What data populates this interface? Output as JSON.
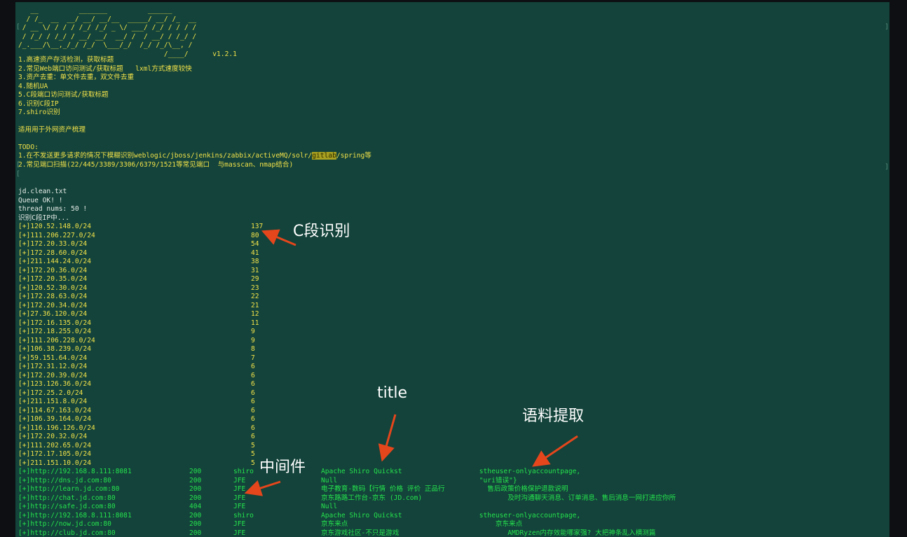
{
  "banner": [
    "   __          _______          ______",
    "  / /_  __  __/ __/ __/__  _____/ __/ /_  __",
    " / __ \\/ / / / /_/ /_/ _ \\/ ___/ /_/ / / / /",
    " / /_/ / /_/ / __/ __/  __/ /  / __/ / /_/ /",
    "/_.___/\\__,_/_/ /_/  \\___/_/  /_/ /_/\\__, /",
    "                                    /____/      v1.2.1"
  ],
  "menu": [
    "1.高速资产存活检测，获取标题",
    "2.常见Web端口访问测试/获取标题   lxml方式速度较快",
    "3.资产去重：单文件去重，双文件去重",
    "4.随机UA",
    "5.C段端口访问测试/获取标题",
    "6.识别C段IP",
    "7.shiro识别"
  ],
  "scope_note": "适用用于外网资产梳理",
  "todo_label": "TODO:",
  "todo1_pre": "1.在不发送更多请求的情况下模糊识别weblogic/jboss/jenkins/zabbix/activeMQ/solr/",
  "todo1_hl": "gitlab",
  "todo1_post": "/spring等",
  "todo2": "2.常见端口扫描(22/445/3389/3306/6379/1521等常见端口  与masscan、nmap结合)",
  "status": [
    "jd.clean.txt",
    "Queue OK! !",
    "thread nums: 50 !",
    "识别C段IP中..."
  ],
  "csegments": [
    {
      "cidr": "[+]120.52.148.0/24",
      "count": "137"
    },
    {
      "cidr": "[+]111.206.227.0/24",
      "count": "80"
    },
    {
      "cidr": "[+]172.20.33.0/24",
      "count": "54"
    },
    {
      "cidr": "[+]172.28.60.0/24",
      "count": "41"
    },
    {
      "cidr": "[+]211.144.24.0/24",
      "count": "38"
    },
    {
      "cidr": "[+]172.20.36.0/24",
      "count": "31"
    },
    {
      "cidr": "[+]172.20.35.0/24",
      "count": "29"
    },
    {
      "cidr": "[+]120.52.30.0/24",
      "count": "23"
    },
    {
      "cidr": "[+]172.28.63.0/24",
      "count": "22"
    },
    {
      "cidr": "[+]172.20.34.0/24",
      "count": "21"
    },
    {
      "cidr": "[+]27.36.120.0/24",
      "count": "12"
    },
    {
      "cidr": "[+]172.16.135.0/24",
      "count": "11"
    },
    {
      "cidr": "[+]172.18.255.0/24",
      "count": "9"
    },
    {
      "cidr": "[+]111.206.228.0/24",
      "count": "9"
    },
    {
      "cidr": "[+]106.38.239.0/24",
      "count": "8"
    },
    {
      "cidr": "[+]59.151.64.0/24",
      "count": "7"
    },
    {
      "cidr": "[+]172.31.12.0/24",
      "count": "6"
    },
    {
      "cidr": "[+]172.20.39.0/24",
      "count": "6"
    },
    {
      "cidr": "[+]123.126.36.0/24",
      "count": "6"
    },
    {
      "cidr": "[+]172.25.2.0/24",
      "count": "6"
    },
    {
      "cidr": "[+]211.151.8.0/24",
      "count": "6"
    },
    {
      "cidr": "[+]114.67.163.0/24",
      "count": "6"
    },
    {
      "cidr": "[+]106.39.164.0/24",
      "count": "6"
    },
    {
      "cidr": "[+]116.196.126.0/24",
      "count": "6"
    },
    {
      "cidr": "[+]172.20.32.0/24",
      "count": "6"
    },
    {
      "cidr": "[+]111.202.65.0/24",
      "count": "5"
    },
    {
      "cidr": "[+]172.17.105.0/24",
      "count": "5"
    },
    {
      "cidr": "[+]211.151.10.0/24",
      "count": "5"
    }
  ],
  "http_results": [
    {
      "url": "[+]http://192.168.8.111:8081",
      "code": "200",
      "mw": "shiro",
      "title": "Apache Shiro Quickst",
      "corpus": "          stheuser-onlyaccountpage,"
    },
    {
      "url": "[+]http://dns.jd.com:80",
      "code": "200",
      "mw": "JFE",
      "title": "Null",
      "corpus": "          \"uri错误\"}"
    },
    {
      "url": "[+]http://learn.jd.com:80",
      "code": "200",
      "mw": "JFE",
      "title": "电子教育-数码【行情 价格 评价 正品行",
      "corpus": "            售后政策价格保护退款说明"
    },
    {
      "url": "[+]http://chat.jd.com:80",
      "code": "200",
      "mw": "JFE",
      "title": "京东路路工作台-京东 (JD.com)",
      "corpus": "                 及时沟通聊天消息、订单消息、售后消息一网打进应你所"
    },
    {
      "url": "[+]http://safe.jd.com:80",
      "code": "404",
      "mw": "JFE",
      "title": "Null",
      "corpus": ""
    },
    {
      "url": "[+]http://192.168.8.111:8081",
      "code": "200",
      "mw": "shiro",
      "title": "Apache Shiro Quickst",
      "corpus": "          stheuser-onlyaccountpage,"
    },
    {
      "url": "[+]http://now.jd.com:80",
      "code": "200",
      "mw": "JFE",
      "title": "京东来点",
      "corpus": "              京东来点"
    },
    {
      "url": "[+]http://club.jd.com:80",
      "code": "200",
      "mw": "JFE",
      "title": "京东游戏社区-不只是游戏",
      "corpus": "                 AMDRyzen内存效能哪家强? 大把神条乱入横测篇"
    }
  ],
  "annotations": {
    "c_segment": "C段识别",
    "title": "title",
    "corpus": "语料提取",
    "middleware": "中间件"
  },
  "colors": {
    "terminal_bg": "#13433a",
    "yellow_text": "#f2e24a",
    "white_text": "#e6ece8",
    "green_text": "#26e34e",
    "arrow": "#e5461c"
  }
}
